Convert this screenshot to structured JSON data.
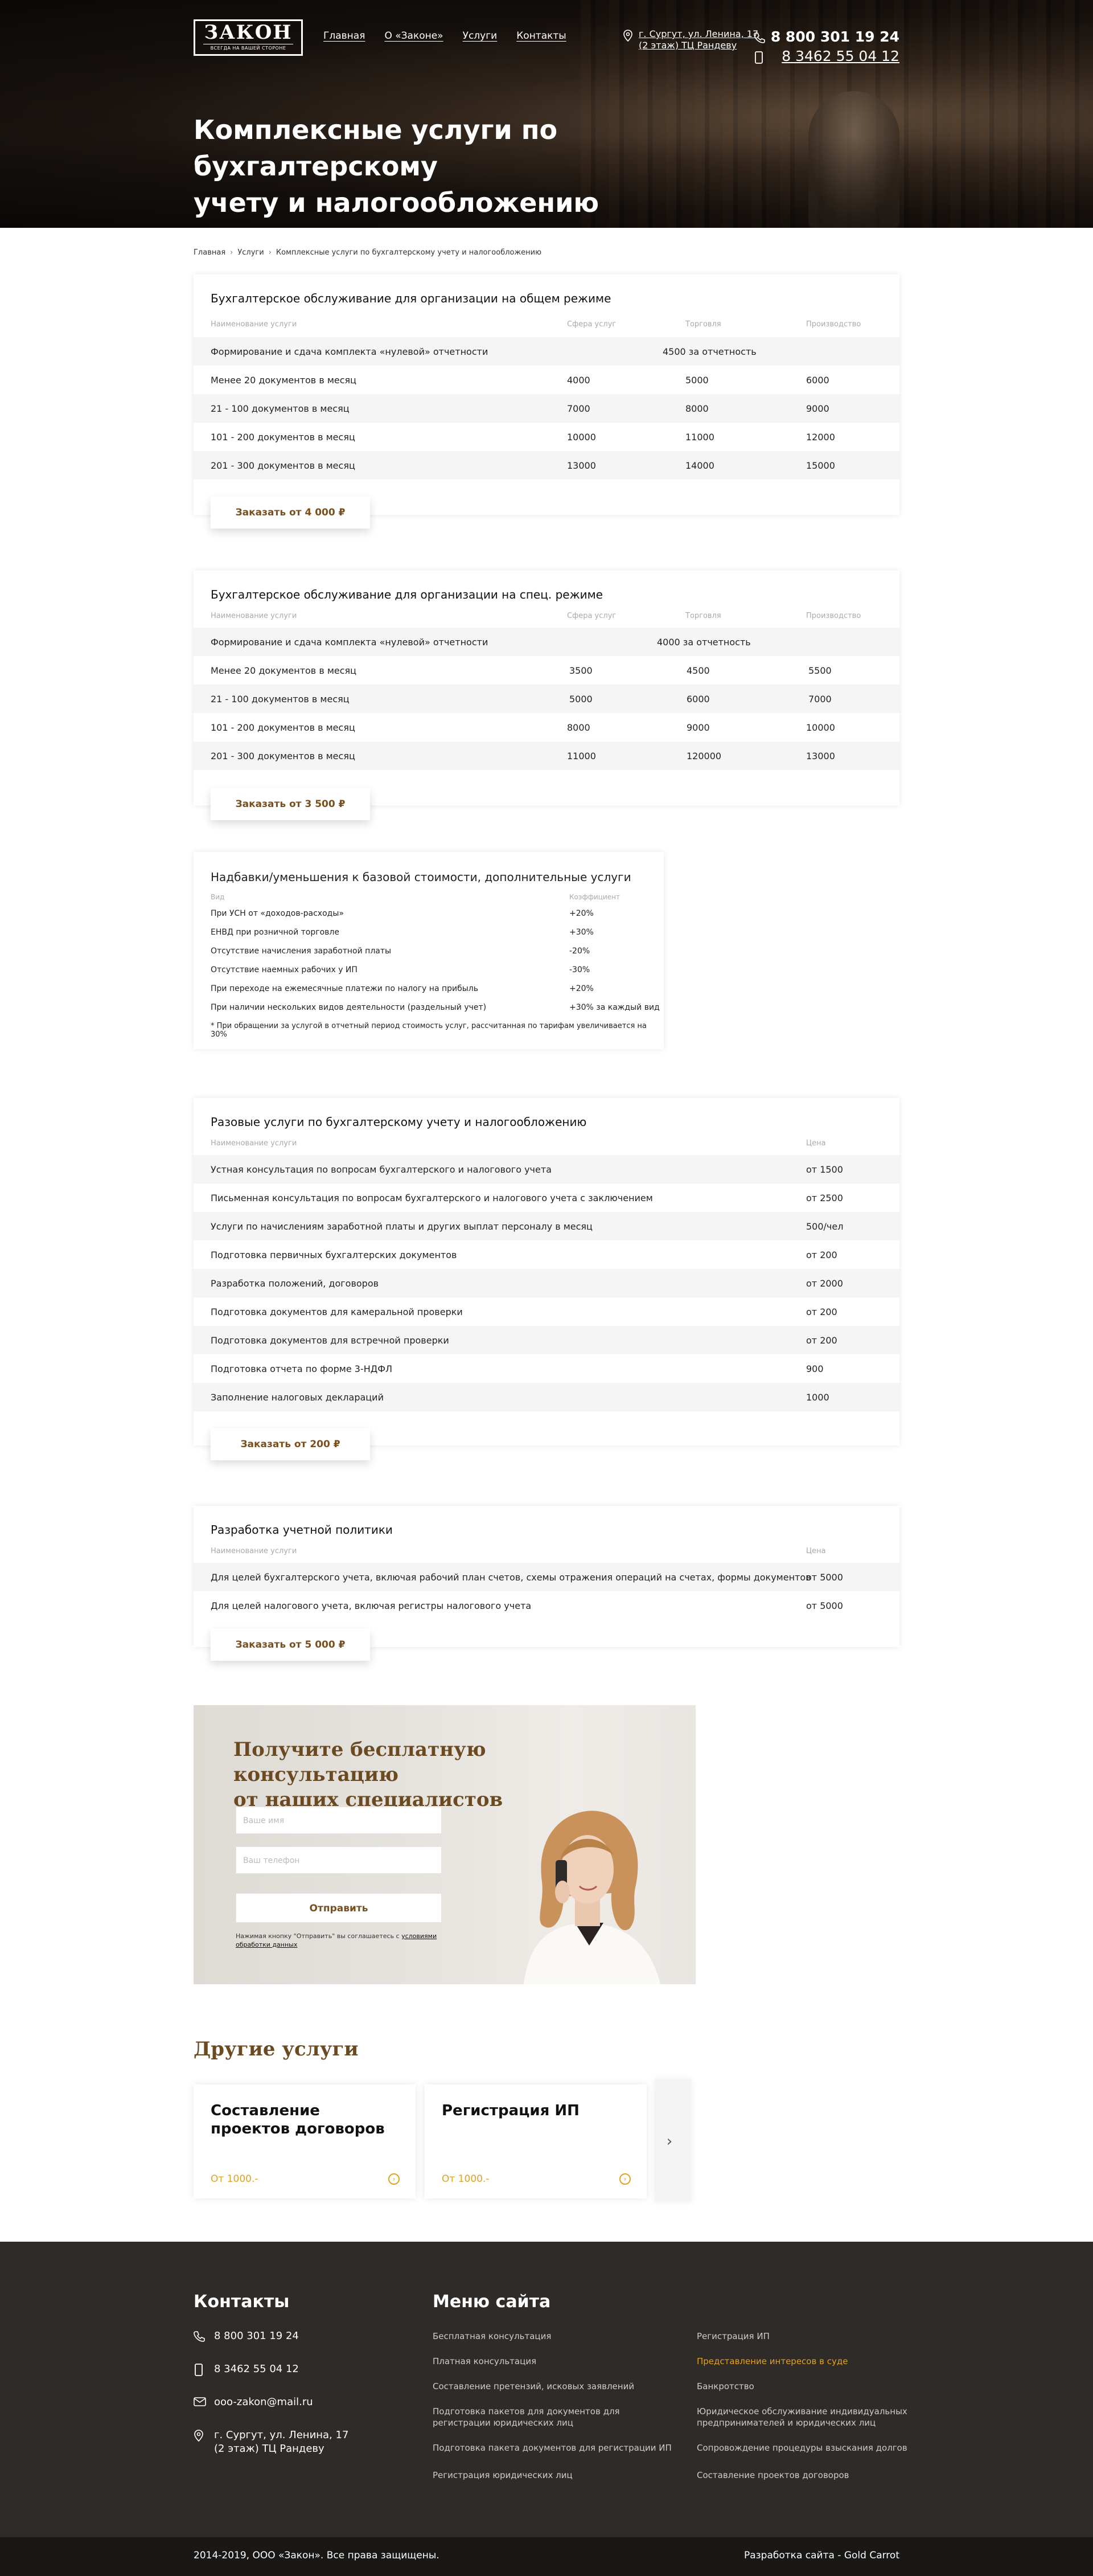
{
  "header": {
    "logo": "ЗАКОН",
    "logo_sub": "ВСЕГДА НА ВАШЕЙ СТОРОНЕ",
    "nav": [
      "Главная",
      "О «Законе»",
      "Услуги",
      "Контакты"
    ],
    "address_line1": "г. Сургут, ул. Ленина, 17",
    "address_line2": "(2 этаж) ТЦ Рандеву",
    "phone1": "8 800 301 19 24",
    "phone2": "8 3462 55 04 12"
  },
  "hero": {
    "title_line1": "Комплексные услуги по бухгалтерскому",
    "title_line2": "учету и налогообложению"
  },
  "breadcrumbs": [
    "Главная",
    "Услуги",
    "Комплексные услуги по бухгалтерскому учету и налогообложению"
  ],
  "table1": {
    "title": "Бухгалтерское обслуживание для организации на общем режиме",
    "headers": [
      "Наименование услуги",
      "Сфера услуг",
      "Торговля",
      "Производство"
    ],
    "merged_row": {
      "name": "Формирование и сдача комплекта «нулевой» отчетности",
      "value": "4500 за отчетность"
    },
    "rows": [
      [
        "Менее 20 документов в месяц",
        "4000",
        "5000",
        "6000"
      ],
      [
        "21 - 100 документов в месяц",
        "7000",
        "8000",
        "9000"
      ],
      [
        "101 - 200 документов в месяц",
        "10000",
        "11000",
        "12000"
      ],
      [
        "201 - 300 документов в месяц",
        "13000",
        "14000",
        "15000"
      ]
    ],
    "button": "Заказать от 4 000 ₽"
  },
  "table2": {
    "title": "Бухгалтерское обслуживание для организации на спец. режиме",
    "headers": [
      "Наименование услуги",
      "Сфера услуг",
      "Торговля",
      "Производство"
    ],
    "merged_row": {
      "name": "Формирование и сдача комплекта «нулевой» отчетности",
      "value": "4000 за отчетность"
    },
    "rows": [
      [
        "Менее 20 документов в месяц",
        "3500",
        "4500",
        "5500"
      ],
      [
        "21 - 100 документов в месяц",
        "5000",
        "6000",
        "7000"
      ],
      [
        "101 - 200 документов в месяц",
        "8000",
        "9000",
        "10000"
      ],
      [
        "201 - 300 документов в месяц",
        "11000",
        "120000",
        "13000"
      ]
    ],
    "button": "Заказать от 3 500 ₽"
  },
  "extras": {
    "title": "Надбавки/уменьшения к базовой стоимости, дополнительные услуги",
    "headers": [
      "Вид",
      "Коэффициент"
    ],
    "rows": [
      [
        "При УСН от «доходов-расходы»",
        "+20%"
      ],
      [
        "ЕНВД при розничной торговле",
        "+30%"
      ],
      [
        "Отсутствие начисления заработной платы",
        "-20%"
      ],
      [
        "Отсутствие наемных рабочих у ИП",
        "-30%"
      ],
      [
        "При переходе на ежемесячные платежи по налогу на прибыль",
        "+20%"
      ],
      [
        "При наличии нескольких видов деятельности (раздельный учет)",
        "+30% за каждый вид"
      ]
    ],
    "note": "* При обращении за услугой в отчетный период стоимость услуг, рассчитанная по тарифам увеличивается на 30%"
  },
  "table3": {
    "title": "Разовые услуги по бухгалтерскому учету и налогообложению",
    "headers": [
      "Наименование услуги",
      "Цена"
    ],
    "rows": [
      [
        "Устная консультация по вопросам бухгалтерского и налогового учета",
        "от 1500"
      ],
      [
        "Письменная консультация по вопросам бухгалтерского и налогового учета с заключением",
        "от 2500"
      ],
      [
        "Услуги по начислениям заработной платы и других выплат персоналу в месяц",
        "500/чел"
      ],
      [
        "Подготовка первичных бухгалтерских документов",
        "от 200"
      ],
      [
        "Разработка положений, договоров",
        "от 2000"
      ],
      [
        "Подготовка документов для камеральной проверки",
        "от 200"
      ],
      [
        "Подготовка документов для встречной проверки",
        "от 200"
      ],
      [
        "Подготовка отчета по форме 3-НДФЛ",
        "900"
      ],
      [
        "Заполнение налоговых деклараций",
        "1000"
      ]
    ],
    "button": "Заказать от 200 ₽"
  },
  "table4": {
    "title": "Разработка учетной политики",
    "headers": [
      "Наименование услуги",
      "Цена"
    ],
    "rows": [
      [
        "Для целей бухгалтерского учета, включая рабочий план счетов, схемы отражения операций на счетах, формы документов",
        "от 5000"
      ],
      [
        "Для целей налогового учета, включая регистры налогового учета",
        "от 5000"
      ]
    ],
    "button": "Заказать от 5 000 ₽"
  },
  "consult": {
    "title_line1": "Получите бесплатную консультацию",
    "title_line2": "от наших специалистов",
    "name_placeholder": "Ваше имя",
    "phone_placeholder": "Ваш телефон",
    "submit": "Отправить",
    "agree_text": "Нажимая кнопку \"Отправить\" вы соглашаетесь с ",
    "agree_link": "условиями обработки данных"
  },
  "other": {
    "title": "Другие услуги",
    "cards": [
      {
        "title": "Составление проектов договоров",
        "price": "От 1000.-"
      },
      {
        "title": "Регистрация ИП",
        "price": "От 1000.-"
      }
    ]
  },
  "footer": {
    "contacts_title": "Контакты",
    "menu_title": "Меню сайта",
    "phone1": "8 800 301 19 24",
    "phone2": "8 3462 55 04 12",
    "email": "ooo-zakon@mail.ru",
    "address_line1": "г. Сургут, ул. Ленина, 17",
    "address_line2": "(2 этаж) ТЦ Рандеву",
    "menu_left": [
      "Бесплатная консультация",
      "Платная консультация",
      "Составление претензий, исковых заявлений",
      "Подготовка пакетов для документов для регистрации юридических лиц",
      "Подготовка пакета документов для регистрации ИП",
      "Регистрация юридических лиц"
    ],
    "menu_right": [
      "Регистрация ИП",
      "Представление интересов в суде",
      "Банкротство",
      "Юридическое обслуживание индивидуальных предпринимателей и юридических лиц",
      "Сопровождение процедуры взыскания долгов",
      "Составление проектов договоров"
    ],
    "active_color": "#e2a21f",
    "copyright": "2014-2019, ООО «Закон». Все права защищены.",
    "dev": "Разработка сайта - Gold Carrot"
  }
}
